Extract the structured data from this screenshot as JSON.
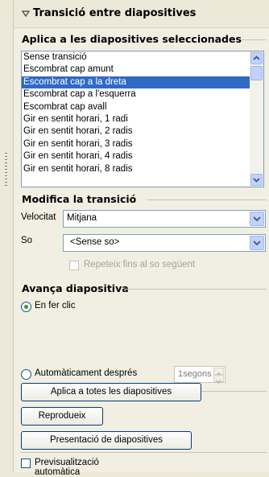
{
  "panel": {
    "title": "Transició entre diapositives"
  },
  "apply_section": {
    "title": "Aplica a les diapositives seleccionades",
    "items": [
      "Sense transició",
      "Escombrat cap amunt",
      "Escombrat cap a la dreta",
      "Escombrat cap a l'esquerra",
      "Escombrat cap avall",
      "Gir en sentit horari, 1 radi",
      "Gir en sentit horari, 2 radis",
      "Gir en sentit horari, 3 radis",
      "Gir en sentit horari, 4 radis",
      "Gir en sentit horari, 8 radis"
    ],
    "selected_item": "Escombrat cap a la dreta"
  },
  "modify_section": {
    "title": "Modifica la transició",
    "speed_label": "Velocitat",
    "speed_value": "Mitjana",
    "sound_label": "So",
    "sound_value": "<Sense so>",
    "repeat_label": "Repeteix fins al so següent"
  },
  "advance_section": {
    "title": "Avança diapositiva",
    "on_click_label": "En fer clic",
    "auto_label": "Automàticament després",
    "auto_value": "1segons"
  },
  "buttons": {
    "apply_all": "Aplica a totes les diapositives",
    "play": "Reprodueix",
    "slideshow": "Presentació de diapositives"
  },
  "autopreview_label": "Previsualització automàtica",
  "colors": {
    "selection": "#316ac5",
    "radio_dot": "#21a121"
  }
}
